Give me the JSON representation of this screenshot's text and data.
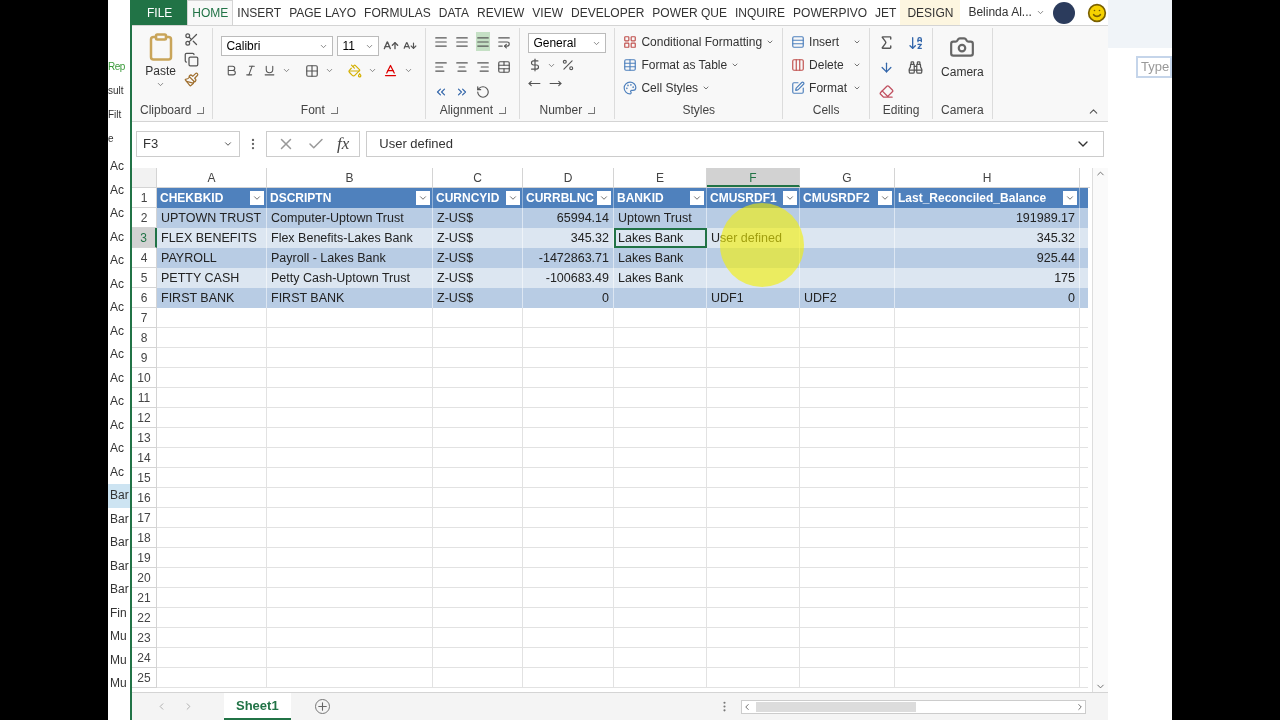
{
  "left_window": {
    "top_labels": [
      "Rep",
      "sult",
      "Filt",
      "e"
    ],
    "items": [
      {
        "label": "Ac",
        "selected": false
      },
      {
        "label": "Ac",
        "selected": false
      },
      {
        "label": "Ac",
        "selected": false
      },
      {
        "label": "Ac",
        "selected": false
      },
      {
        "label": "Ac",
        "selected": false
      },
      {
        "label": "Ac",
        "selected": false
      },
      {
        "label": "Ac",
        "selected": false
      },
      {
        "label": "Ac",
        "selected": false
      },
      {
        "label": "Ac",
        "selected": false
      },
      {
        "label": "Ac",
        "selected": false
      },
      {
        "label": "Ac",
        "selected": false
      },
      {
        "label": "Ac",
        "selected": false
      },
      {
        "label": "Ac",
        "selected": false
      },
      {
        "label": "Ac",
        "selected": false
      },
      {
        "label": "Bar",
        "selected": true
      },
      {
        "label": "Bar",
        "selected": false
      },
      {
        "label": "Bar",
        "selected": false
      },
      {
        "label": "Bar",
        "selected": false
      },
      {
        "label": "Bar",
        "selected": false
      },
      {
        "label": "Fin",
        "selected": false
      },
      {
        "label": "Mu",
        "selected": false
      },
      {
        "label": "Mu",
        "selected": false
      },
      {
        "label": "Mu",
        "selected": false
      }
    ]
  },
  "right_window": {
    "search": {
      "placeholder": "Type"
    }
  },
  "ribbon_tabs": [
    {
      "label": "FILE",
      "kind": "file",
      "selected": false
    },
    {
      "label": "HOME",
      "kind": "tab",
      "selected": true
    },
    {
      "label": "INSERT",
      "kind": "tab",
      "selected": false
    },
    {
      "label": "PAGE LAYO",
      "kind": "tab",
      "selected": false
    },
    {
      "label": "FORMULAS",
      "kind": "tab",
      "selected": false
    },
    {
      "label": "DATA",
      "kind": "tab",
      "selected": false
    },
    {
      "label": "REVIEW",
      "kind": "tab",
      "selected": false
    },
    {
      "label": "VIEW",
      "kind": "tab",
      "selected": false
    },
    {
      "label": "DEVELOPER",
      "kind": "tab",
      "selected": false
    },
    {
      "label": "POWER QUE",
      "kind": "tab",
      "selected": false
    },
    {
      "label": "INQUIRE",
      "kind": "tab",
      "selected": false
    },
    {
      "label": "POWERPIVO",
      "kind": "tab",
      "selected": false
    },
    {
      "label": "JET",
      "kind": "tab",
      "selected": false
    },
    {
      "label": "DESIGN",
      "kind": "contextual",
      "selected": false
    }
  ],
  "account": {
    "name": "Belinda Al..."
  },
  "ribbon_groups": [
    {
      "kind": "clipboard",
      "label": "Clipboard",
      "paste_label": "Paste"
    },
    {
      "kind": "font",
      "label": "Font",
      "font_name": "Calibri",
      "font_size": "11"
    },
    {
      "kind": "alignment",
      "label": "Alignment"
    },
    {
      "kind": "number",
      "label": "Number",
      "format": "General"
    },
    {
      "kind": "styles",
      "label": "Styles",
      "commands": [
        "Conditional Formatting",
        "Format as Table",
        "Cell Styles"
      ]
    },
    {
      "kind": "cells",
      "label": "Cells",
      "commands": [
        "Insert",
        "Delete",
        "Format"
      ]
    },
    {
      "kind": "editing",
      "label": "Editing"
    },
    {
      "kind": "camera",
      "label": "Camera",
      "command": "Camera"
    }
  ],
  "formula_bar": {
    "name_box": "F3",
    "function_symbol": "fx",
    "value": "User defined"
  },
  "columns": [
    {
      "letter": "A",
      "selected": false
    },
    {
      "letter": "B",
      "selected": false
    },
    {
      "letter": "C",
      "selected": false
    },
    {
      "letter": "D",
      "selected": false
    },
    {
      "letter": "E",
      "selected": false
    },
    {
      "letter": "F",
      "selected": true
    },
    {
      "letter": "G",
      "selected": false
    },
    {
      "letter": "H",
      "selected": false
    }
  ],
  "row_numbers": [
    {
      "label": "1",
      "selected": false
    },
    {
      "label": "2",
      "selected": false
    },
    {
      "label": "3",
      "selected": true
    },
    {
      "label": "4",
      "selected": false
    },
    {
      "label": "5",
      "selected": false
    },
    {
      "label": "6",
      "selected": false
    },
    {
      "label": "7",
      "selected": false
    },
    {
      "label": "8",
      "selected": false
    },
    {
      "label": "9",
      "selected": false
    },
    {
      "label": "10",
      "selected": false
    },
    {
      "label": "11",
      "selected": false
    },
    {
      "label": "12",
      "selected": false
    },
    {
      "label": "13",
      "selected": false
    },
    {
      "label": "14",
      "selected": false
    },
    {
      "label": "15",
      "selected": false
    },
    {
      "label": "16",
      "selected": false
    },
    {
      "label": "17",
      "selected": false
    },
    {
      "label": "18",
      "selected": false
    },
    {
      "label": "19",
      "selected": false
    },
    {
      "label": "20",
      "selected": false
    },
    {
      "label": "21",
      "selected": false
    },
    {
      "label": "22",
      "selected": false
    },
    {
      "label": "23",
      "selected": false
    },
    {
      "label": "24",
      "selected": false
    },
    {
      "label": "25",
      "selected": false
    }
  ],
  "table": {
    "columns": [
      {
        "header": "CHEKBKID",
        "numeric": false
      },
      {
        "header": "DSCRIPTN",
        "numeric": false
      },
      {
        "header": "CURNCYID",
        "numeric": false
      },
      {
        "header": "CURRBLNC",
        "numeric": true
      },
      {
        "header": "BANKID",
        "numeric": false
      },
      {
        "header": "CMUSRDF1",
        "numeric": false
      },
      {
        "header": "CMUSRDF2",
        "numeric": false
      },
      {
        "header": "Last_Reconciled_Balance",
        "numeric": true
      }
    ],
    "rows": [
      {
        "cells": [
          {
            "text": "UPTOWN TRUST",
            "active": false
          },
          {
            "text": "Computer-Uptown Trust",
            "active": false
          },
          {
            "text": "Z-US$",
            "active": false
          },
          {
            "text": "65994.14",
            "active": false
          },
          {
            "text": "Uptown Trust",
            "active": false
          },
          {
            "active": false
          },
          {
            "active": false
          },
          {
            "text": "191989.17",
            "active": false
          }
        ]
      },
      {
        "cells": [
          {
            "text": "FLEX BENEFITS",
            "active": false
          },
          {
            "text": "Flex Benefits-Lakes Bank",
            "active": false
          },
          {
            "text": "Z-US$",
            "active": false
          },
          {
            "text": "345.32",
            "active": false
          },
          {
            "text": "Lakes Bank",
            "active": true
          },
          {
            "text": "User defined",
            "active": false
          },
          {
            "active": false
          },
          {
            "text": "345.32",
            "active": false
          }
        ]
      },
      {
        "cells": [
          {
            "text": "PAYROLL",
            "active": false
          },
          {
            "text": "Payroll - Lakes Bank",
            "active": false
          },
          {
            "text": "Z-US$",
            "active": false
          },
          {
            "text": "-1472863.71",
            "active": false
          },
          {
            "text": "Lakes Bank",
            "active": false
          },
          {
            "active": false
          },
          {
            "active": false
          },
          {
            "text": "925.44",
            "active": false
          }
        ]
      },
      {
        "cells": [
          {
            "text": "PETTY CASH",
            "active": false
          },
          {
            "text": "Petty Cash-Uptown Trust",
            "active": false
          },
          {
            "text": "Z-US$",
            "active": false
          },
          {
            "text": "-100683.49",
            "active": false
          },
          {
            "text": "Lakes Bank",
            "active": false
          },
          {
            "active": false
          },
          {
            "active": false
          },
          {
            "text": "175",
            "active": false
          }
        ]
      },
      {
        "cells": [
          {
            "text": "FIRST BANK",
            "active": false
          },
          {
            "text": "FIRST BANK",
            "active": false
          },
          {
            "text": "Z-US$",
            "active": false
          },
          {
            "text": "0",
            "active": false
          },
          {
            "active": false
          },
          {
            "text": "UDF1",
            "active": false
          },
          {
            "text": "UDF2",
            "active": false
          },
          {
            "text": "0",
            "active": false
          }
        ]
      }
    ]
  },
  "sheet_tabs": [
    {
      "label": "Sheet1",
      "selected": true
    }
  ]
}
